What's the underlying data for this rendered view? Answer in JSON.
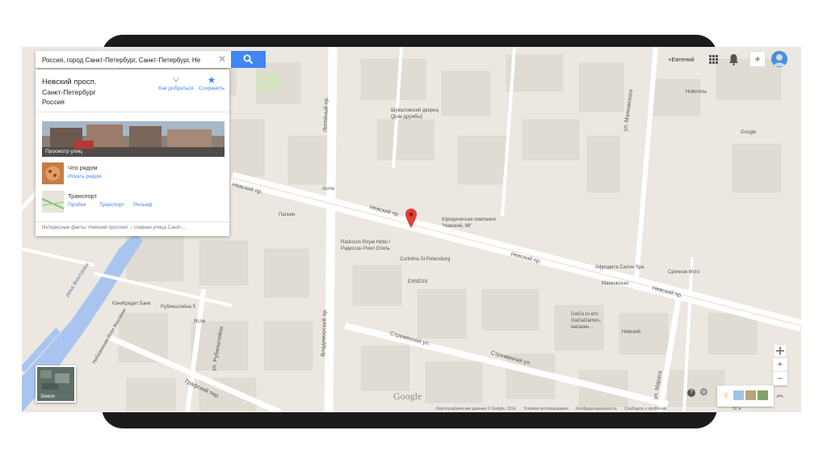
{
  "search": {
    "value": "Россия, город Санкт-Петербург, Санкт-Петербург, Не",
    "clear_icon": "close-icon",
    "button_icon": "search-icon"
  },
  "place": {
    "name": "Невский просп.",
    "city": "Санкт-Петербург",
    "country": "Россия",
    "directions_label": "Как добраться",
    "save_label": "Сохранить"
  },
  "streetview": {
    "label": "Просмотр улиц"
  },
  "nearby": {
    "title": "Что рядом",
    "link": "Искать рядом"
  },
  "transport": {
    "title": "Транспорт",
    "links": [
      "Пробки",
      "Транспорт",
      "Рельеф"
    ]
  },
  "facts": "Интересные факты: Невский проспект – главная улица Санкт-...",
  "topbar": {
    "user": "+Евгений",
    "apps_icon": "apps-grid-icon",
    "bell_icon": "bell-icon",
    "plus": "+"
  },
  "zoom": {
    "plus": "+",
    "minus": "–"
  },
  "earth": {
    "label": "Земля"
  },
  "logo": "Google",
  "footer": [
    "Картографические данные © Google, 2014",
    "Условия использования",
    "Конфиденциальность",
    "Сообщить о проблеме"
  ],
  "scale": "50 м",
  "map_labels": {
    "nevsky1": "Невский пр.",
    "nevsky2": "Невский пр.",
    "nevsky3": "Невский пр.",
    "nevsky4": "Невский пр.",
    "liteyny": "Литейный пр.",
    "vladimirsky": "Владимирский пр.",
    "rubinshteina": "ул. Рубинштейна",
    "stremyannaya1": "Стремянная ул.",
    "stremyannaya2": "Стремянная ул.",
    "marata": "ул. Марата",
    "mayakovskogo": "ул. Маяковского",
    "grafsky": "Графский пер.",
    "fontanka": "река Фонтанка",
    "fontanka_emb": "Набережная Реки Фонтанки",
    "shuvalov": "Шуваловский дворец (Дом дружбы)",
    "yurid": "Юридическая компания \"Невский, 88\"",
    "radisson": "Radisson Royal Hotel / Рэдиссон Роял Отель",
    "corinthia": "Corinthia St.Petersburg",
    "exness": "EXNESS",
    "mayakovskaya": "Маяковская",
    "aphrodita": "Афродита Салон Spa",
    "sro": "Срочное Фото",
    "gaga": "GaGa.ru его GaGaGames, магазин...",
    "nevsky_store": "Невский",
    "palkin": "Палкин",
    "acme": "Acme",
    "novotel": "Новотель",
    "google_office": "Google",
    "unicredit": "ЮниКредит Банк",
    "rubinshteina5": "Рубинштейна 5",
    "yasli": "Ясли"
  }
}
